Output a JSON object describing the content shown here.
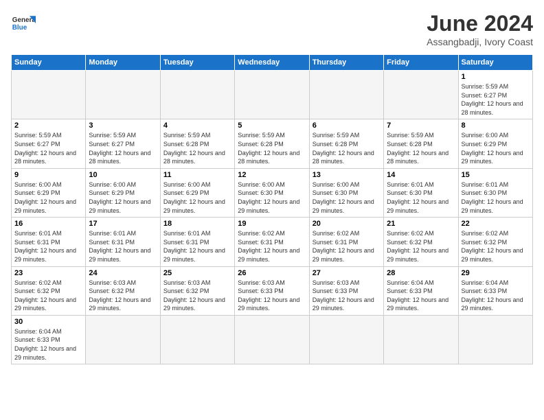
{
  "header": {
    "logo_general": "General",
    "logo_blue": "Blue",
    "title": "June 2024",
    "subtitle": "Assangbadji, Ivory Coast"
  },
  "days_of_week": [
    "Sunday",
    "Monday",
    "Tuesday",
    "Wednesday",
    "Thursday",
    "Friday",
    "Saturday"
  ],
  "weeks": [
    {
      "days": [
        {
          "num": "",
          "info": ""
        },
        {
          "num": "",
          "info": ""
        },
        {
          "num": "",
          "info": ""
        },
        {
          "num": "",
          "info": ""
        },
        {
          "num": "",
          "info": ""
        },
        {
          "num": "",
          "info": ""
        },
        {
          "num": "1",
          "info": "Sunrise: 5:59 AM\nSunset: 6:27 PM\nDaylight: 12 hours and 28 minutes."
        }
      ]
    },
    {
      "days": [
        {
          "num": "2",
          "info": "Sunrise: 5:59 AM\nSunset: 6:27 PM\nDaylight: 12 hours and 28 minutes."
        },
        {
          "num": "3",
          "info": "Sunrise: 5:59 AM\nSunset: 6:27 PM\nDaylight: 12 hours and 28 minutes."
        },
        {
          "num": "4",
          "info": "Sunrise: 5:59 AM\nSunset: 6:28 PM\nDaylight: 12 hours and 28 minutes."
        },
        {
          "num": "5",
          "info": "Sunrise: 5:59 AM\nSunset: 6:28 PM\nDaylight: 12 hours and 28 minutes."
        },
        {
          "num": "6",
          "info": "Sunrise: 5:59 AM\nSunset: 6:28 PM\nDaylight: 12 hours and 28 minutes."
        },
        {
          "num": "7",
          "info": "Sunrise: 5:59 AM\nSunset: 6:28 PM\nDaylight: 12 hours and 28 minutes."
        },
        {
          "num": "8",
          "info": "Sunrise: 6:00 AM\nSunset: 6:29 PM\nDaylight: 12 hours and 29 minutes."
        }
      ]
    },
    {
      "days": [
        {
          "num": "9",
          "info": "Sunrise: 6:00 AM\nSunset: 6:29 PM\nDaylight: 12 hours and 29 minutes."
        },
        {
          "num": "10",
          "info": "Sunrise: 6:00 AM\nSunset: 6:29 PM\nDaylight: 12 hours and 29 minutes."
        },
        {
          "num": "11",
          "info": "Sunrise: 6:00 AM\nSunset: 6:29 PM\nDaylight: 12 hours and 29 minutes."
        },
        {
          "num": "12",
          "info": "Sunrise: 6:00 AM\nSunset: 6:30 PM\nDaylight: 12 hours and 29 minutes."
        },
        {
          "num": "13",
          "info": "Sunrise: 6:00 AM\nSunset: 6:30 PM\nDaylight: 12 hours and 29 minutes."
        },
        {
          "num": "14",
          "info": "Sunrise: 6:01 AM\nSunset: 6:30 PM\nDaylight: 12 hours and 29 minutes."
        },
        {
          "num": "15",
          "info": "Sunrise: 6:01 AM\nSunset: 6:30 PM\nDaylight: 12 hours and 29 minutes."
        }
      ]
    },
    {
      "days": [
        {
          "num": "16",
          "info": "Sunrise: 6:01 AM\nSunset: 6:31 PM\nDaylight: 12 hours and 29 minutes."
        },
        {
          "num": "17",
          "info": "Sunrise: 6:01 AM\nSunset: 6:31 PM\nDaylight: 12 hours and 29 minutes."
        },
        {
          "num": "18",
          "info": "Sunrise: 6:01 AM\nSunset: 6:31 PM\nDaylight: 12 hours and 29 minutes."
        },
        {
          "num": "19",
          "info": "Sunrise: 6:02 AM\nSunset: 6:31 PM\nDaylight: 12 hours and 29 minutes."
        },
        {
          "num": "20",
          "info": "Sunrise: 6:02 AM\nSunset: 6:31 PM\nDaylight: 12 hours and 29 minutes."
        },
        {
          "num": "21",
          "info": "Sunrise: 6:02 AM\nSunset: 6:32 PM\nDaylight: 12 hours and 29 minutes."
        },
        {
          "num": "22",
          "info": "Sunrise: 6:02 AM\nSunset: 6:32 PM\nDaylight: 12 hours and 29 minutes."
        }
      ]
    },
    {
      "days": [
        {
          "num": "23",
          "info": "Sunrise: 6:02 AM\nSunset: 6:32 PM\nDaylight: 12 hours and 29 minutes."
        },
        {
          "num": "24",
          "info": "Sunrise: 6:03 AM\nSunset: 6:32 PM\nDaylight: 12 hours and 29 minutes."
        },
        {
          "num": "25",
          "info": "Sunrise: 6:03 AM\nSunset: 6:32 PM\nDaylight: 12 hours and 29 minutes."
        },
        {
          "num": "26",
          "info": "Sunrise: 6:03 AM\nSunset: 6:33 PM\nDaylight: 12 hours and 29 minutes."
        },
        {
          "num": "27",
          "info": "Sunrise: 6:03 AM\nSunset: 6:33 PM\nDaylight: 12 hours and 29 minutes."
        },
        {
          "num": "28",
          "info": "Sunrise: 6:04 AM\nSunset: 6:33 PM\nDaylight: 12 hours and 29 minutes."
        },
        {
          "num": "29",
          "info": "Sunrise: 6:04 AM\nSunset: 6:33 PM\nDaylight: 12 hours and 29 minutes."
        }
      ]
    },
    {
      "days": [
        {
          "num": "30",
          "info": "Sunrise: 6:04 AM\nSunset: 6:33 PM\nDaylight: 12 hours and 29 minutes."
        },
        {
          "num": "",
          "info": ""
        },
        {
          "num": "",
          "info": ""
        },
        {
          "num": "",
          "info": ""
        },
        {
          "num": "",
          "info": ""
        },
        {
          "num": "",
          "info": ""
        },
        {
          "num": "",
          "info": ""
        }
      ]
    }
  ]
}
